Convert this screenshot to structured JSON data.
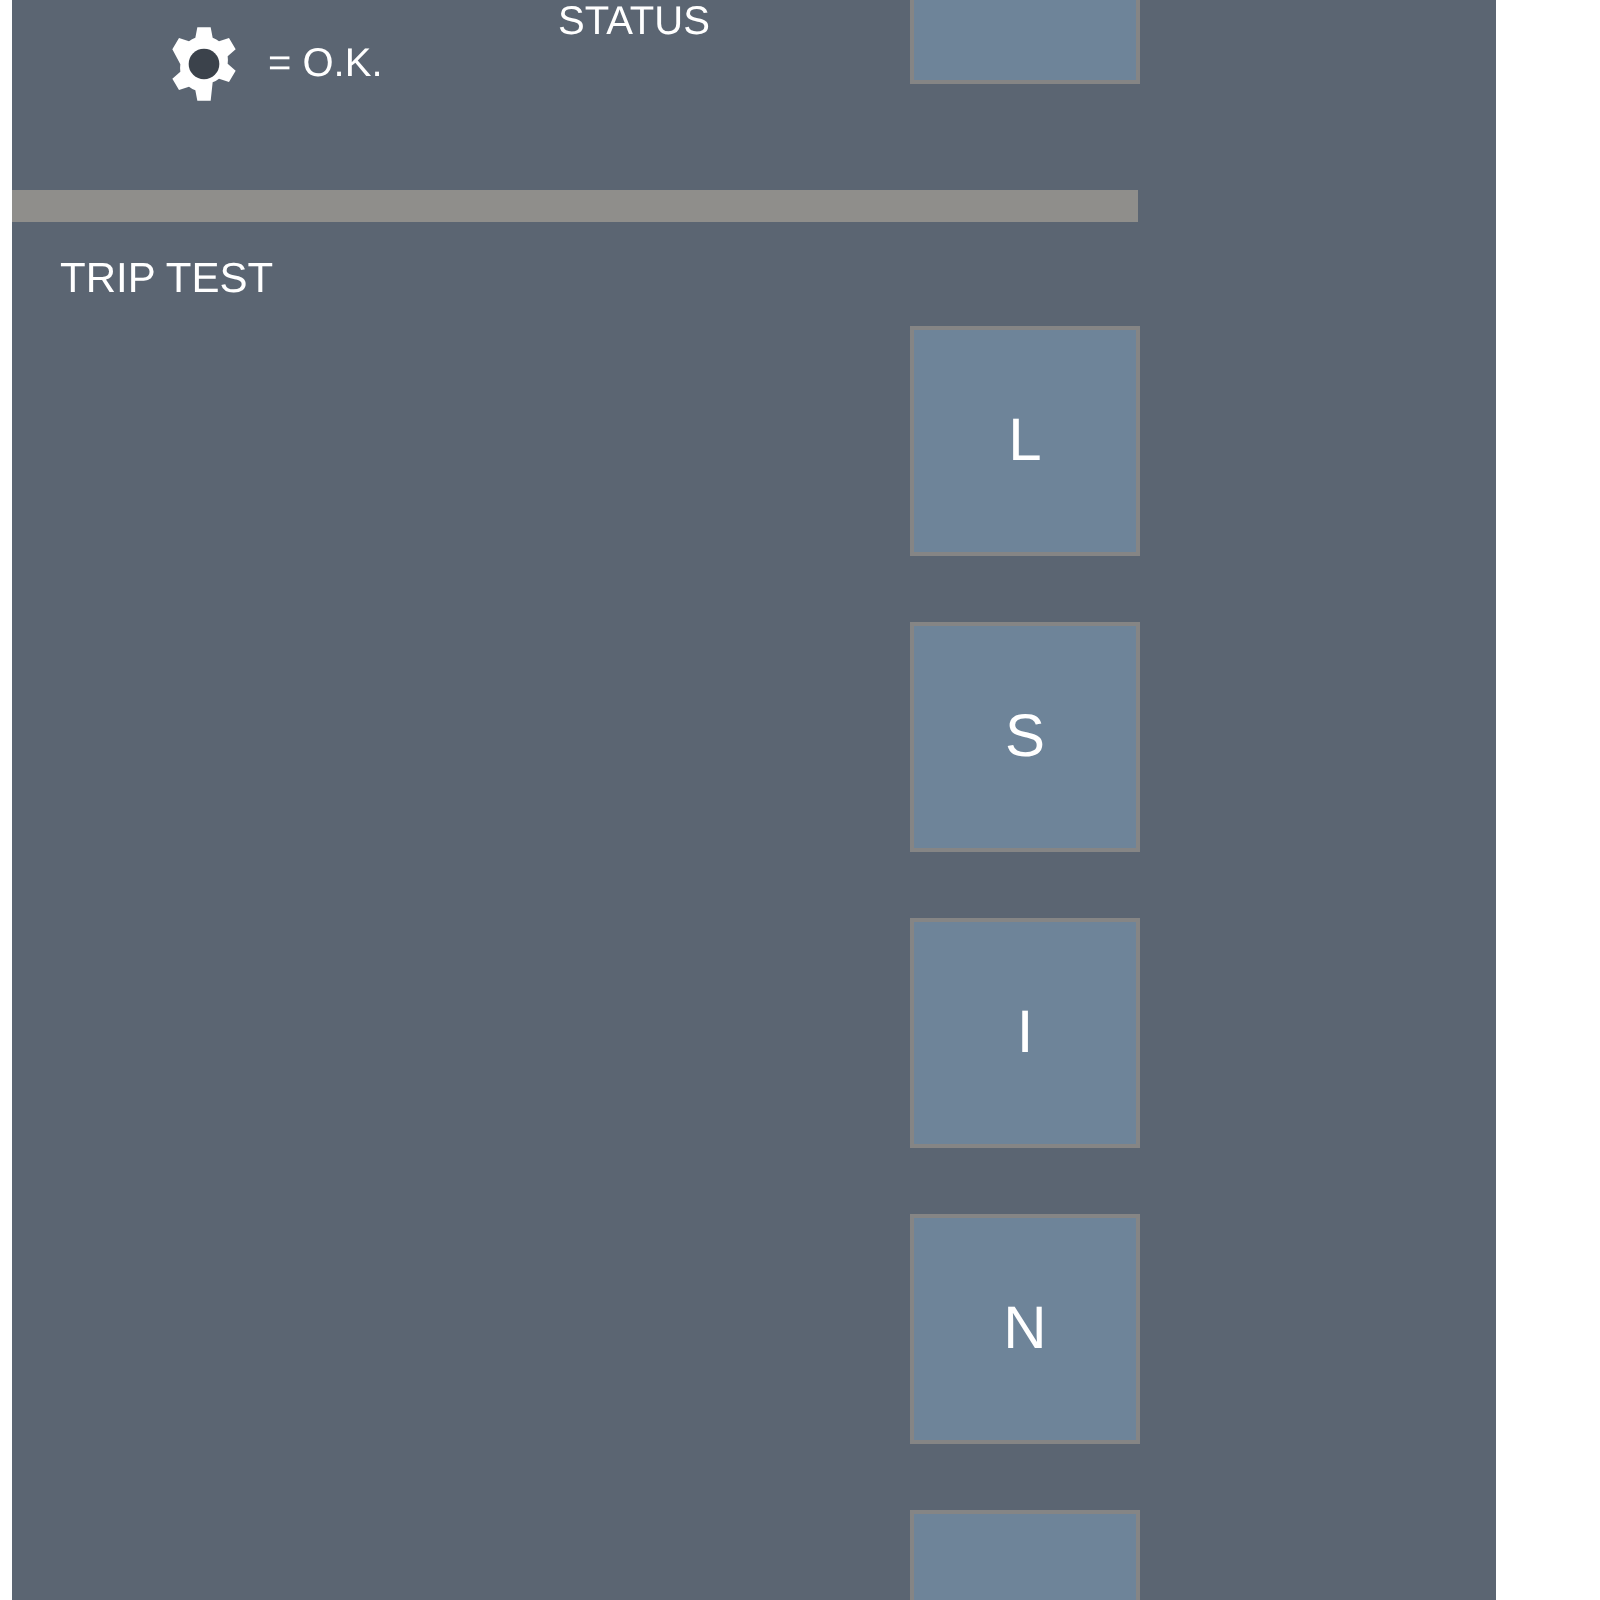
{
  "status": {
    "label": "STATUS",
    "legend": "= O.K."
  },
  "status_button": {
    "kind": "blank"
  },
  "trip_test": {
    "title": "TRIP TEST",
    "buttons": [
      {
        "kind": "letter",
        "label": "L"
      },
      {
        "kind": "letter",
        "label": "S"
      },
      {
        "kind": "letter",
        "label": "I"
      },
      {
        "kind": "letter",
        "label": "N"
      },
      {
        "kind": "blank"
      }
    ]
  }
}
